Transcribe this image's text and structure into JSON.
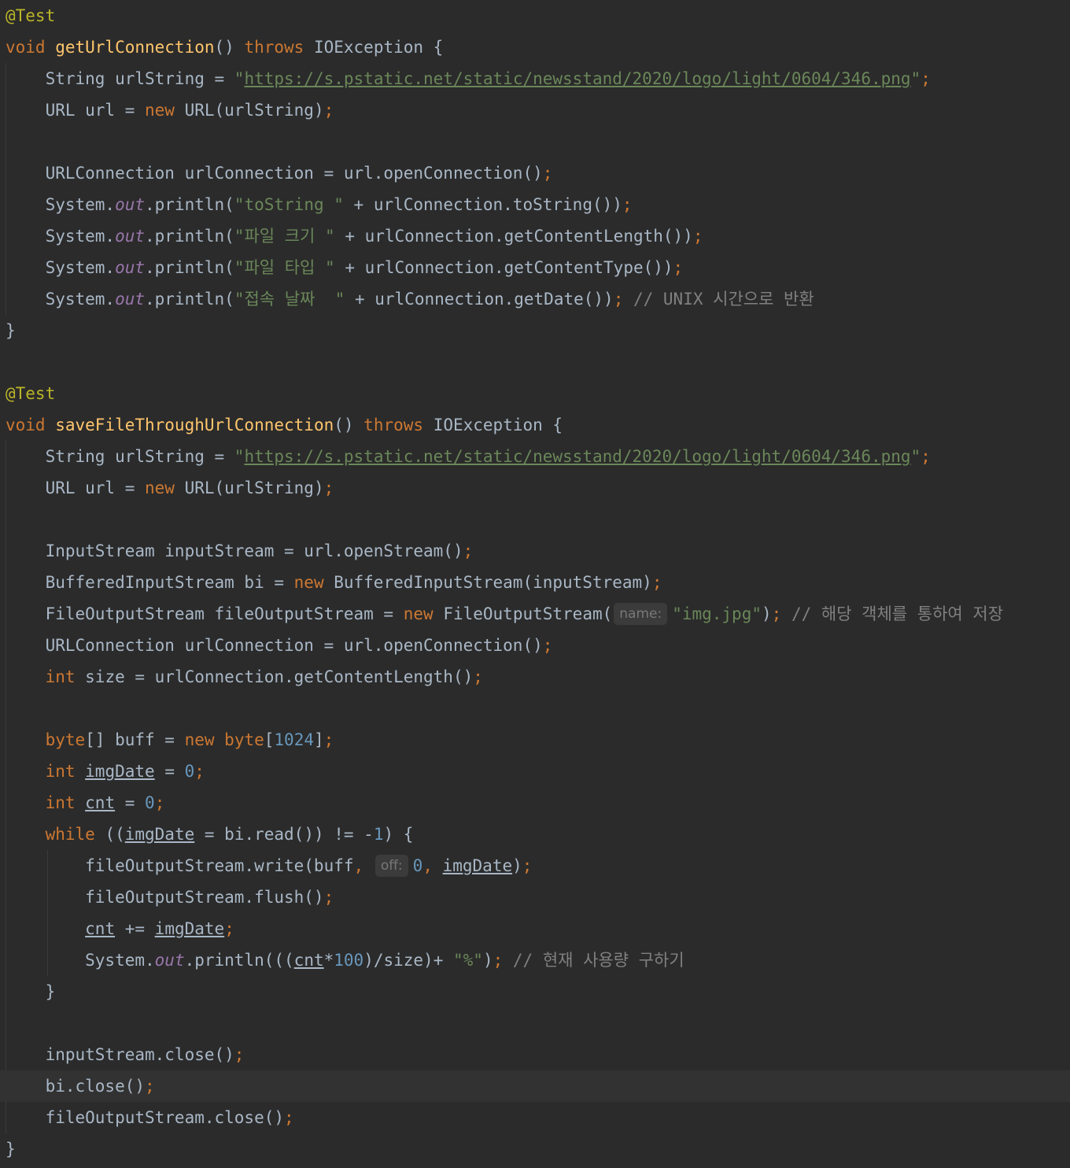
{
  "editor": {
    "lines": [
      [
        {
          "t": "@Test",
          "c": "ann"
        }
      ],
      [
        {
          "t": "void ",
          "c": "kw"
        },
        {
          "t": "getUrlConnection",
          "c": "fn"
        },
        {
          "t": "() "
        },
        {
          "t": "throws ",
          "c": "kw"
        },
        {
          "t": "IOException {"
        }
      ],
      [
        {
          "t": "    String urlString = "
        },
        {
          "t": "\"",
          "c": "str"
        },
        {
          "t": "https://s.pstatic.net/static/newsstand/2020/logo/light/0604/346.png",
          "c": "str link"
        },
        {
          "t": "\"",
          "c": "str"
        },
        {
          "t": ";",
          "c": "punc"
        }
      ],
      [
        {
          "t": "    URL url = "
        },
        {
          "t": "new ",
          "c": "kw"
        },
        {
          "t": "URL(urlString)"
        },
        {
          "t": ";",
          "c": "punc"
        }
      ],
      [],
      [
        {
          "t": "    URLConnection urlConnection = url.openConnection()"
        },
        {
          "t": ";",
          "c": "punc"
        }
      ],
      [
        {
          "t": "    System."
        },
        {
          "t": "out",
          "c": "stat"
        },
        {
          "t": ".println("
        },
        {
          "t": "\"toString \"",
          "c": "str"
        },
        {
          "t": " + urlConnection.toString())"
        },
        {
          "t": ";",
          "c": "punc"
        }
      ],
      [
        {
          "t": "    System."
        },
        {
          "t": "out",
          "c": "stat"
        },
        {
          "t": ".println("
        },
        {
          "t": "\"파일 크기 \"",
          "c": "str"
        },
        {
          "t": " + urlConnection.getContentLength())"
        },
        {
          "t": ";",
          "c": "punc"
        }
      ],
      [
        {
          "t": "    System."
        },
        {
          "t": "out",
          "c": "stat"
        },
        {
          "t": ".println("
        },
        {
          "t": "\"파일 타입 \"",
          "c": "str"
        },
        {
          "t": " + urlConnection.getContentType())"
        },
        {
          "t": ";",
          "c": "punc"
        }
      ],
      [
        {
          "t": "    System."
        },
        {
          "t": "out",
          "c": "stat"
        },
        {
          "t": ".println("
        },
        {
          "t": "\"접속 날짜  \"",
          "c": "str"
        },
        {
          "t": " + urlConnection.getDate())"
        },
        {
          "t": "; ",
          "c": "punc"
        },
        {
          "t": "// UNIX 시간으로 반환",
          "c": "cmt"
        }
      ],
      [
        {
          "t": "}"
        }
      ],
      [],
      [
        {
          "t": "@Test",
          "c": "ann"
        }
      ],
      [
        {
          "t": "void ",
          "c": "kw"
        },
        {
          "t": "saveFileThroughUrlConnection",
          "c": "fn"
        },
        {
          "t": "() "
        },
        {
          "t": "throws ",
          "c": "kw"
        },
        {
          "t": "IOException {"
        }
      ],
      [
        {
          "t": "    String urlString = "
        },
        {
          "t": "\"",
          "c": "str"
        },
        {
          "t": "https://s.pstatic.net/static/newsstand/2020/logo/light/0604/346.png",
          "c": "str link"
        },
        {
          "t": "\"",
          "c": "str"
        },
        {
          "t": ";",
          "c": "punc"
        }
      ],
      [
        {
          "t": "    URL url = "
        },
        {
          "t": "new ",
          "c": "kw"
        },
        {
          "t": "URL(urlString)"
        },
        {
          "t": ";",
          "c": "punc"
        }
      ],
      [],
      [
        {
          "t": "    InputStream inputStream = url.openStream()"
        },
        {
          "t": ";",
          "c": "punc"
        }
      ],
      [
        {
          "t": "    BufferedInputStream bi = "
        },
        {
          "t": "new ",
          "c": "kw"
        },
        {
          "t": "BufferedInputStream(inputStream)"
        },
        {
          "t": ";",
          "c": "punc"
        }
      ],
      [
        {
          "t": "    FileOutputStream fileOutputStream = "
        },
        {
          "t": "new ",
          "c": "kw"
        },
        {
          "t": "FileOutputStream("
        },
        {
          "t": "name:",
          "c": "hint"
        },
        {
          "t": "\"img.jpg\"",
          "c": "str"
        },
        {
          "t": ")"
        },
        {
          "t": "; ",
          "c": "punc"
        },
        {
          "t": "// 해당 객체를 통하여 저장",
          "c": "cmt"
        }
      ],
      [
        {
          "t": "    URLConnection urlConnection = url.openConnection()"
        },
        {
          "t": ";",
          "c": "punc"
        }
      ],
      [
        {
          "t": "    "
        },
        {
          "t": "int ",
          "c": "kw"
        },
        {
          "t": "size = urlConnection.getContentLength()"
        },
        {
          "t": ";",
          "c": "punc"
        }
      ],
      [],
      [
        {
          "t": "    "
        },
        {
          "t": "byte",
          "c": "kw"
        },
        {
          "t": "[] buff = "
        },
        {
          "t": "new ",
          "c": "kw"
        },
        {
          "t": "byte",
          "c": "kw"
        },
        {
          "t": "["
        },
        {
          "t": "1024",
          "c": "num"
        },
        {
          "t": "]"
        },
        {
          "t": ";",
          "c": "punc"
        }
      ],
      [
        {
          "t": "    "
        },
        {
          "t": "int ",
          "c": "kw"
        },
        {
          "t": "imgDate",
          "c": "uvar"
        },
        {
          "t": " = "
        },
        {
          "t": "0",
          "c": "num"
        },
        {
          "t": ";",
          "c": "punc"
        }
      ],
      [
        {
          "t": "    "
        },
        {
          "t": "int ",
          "c": "kw"
        },
        {
          "t": "cnt",
          "c": "uvar"
        },
        {
          "t": " = "
        },
        {
          "t": "0",
          "c": "num"
        },
        {
          "t": ";",
          "c": "punc"
        }
      ],
      [
        {
          "t": "    "
        },
        {
          "t": "while ",
          "c": "kw"
        },
        {
          "t": "(("
        },
        {
          "t": "imgDate",
          "c": "uvar"
        },
        {
          "t": " = bi.read()) != -"
        },
        {
          "t": "1",
          "c": "num"
        },
        {
          "t": ") {"
        }
      ],
      [
        {
          "t": "        fileOutputStream.write(buff"
        },
        {
          "t": ", ",
          "c": "punc"
        },
        {
          "t": "off:",
          "c": "hint"
        },
        {
          "t": "0",
          "c": "num"
        },
        {
          "t": ", ",
          "c": "punc"
        },
        {
          "t": "imgDate",
          "c": "uvar"
        },
        {
          "t": ")"
        },
        {
          "t": ";",
          "c": "punc"
        }
      ],
      [
        {
          "t": "        fileOutputStream.flush()"
        },
        {
          "t": ";",
          "c": "punc"
        }
      ],
      [
        {
          "t": "        "
        },
        {
          "t": "cnt",
          "c": "uvar"
        },
        {
          "t": " += "
        },
        {
          "t": "imgDate",
          "c": "uvar"
        },
        {
          "t": ";",
          "c": "punc"
        }
      ],
      [
        {
          "t": "        System."
        },
        {
          "t": "out",
          "c": "stat"
        },
        {
          "t": ".println((("
        },
        {
          "t": "cnt",
          "c": "uvar"
        },
        {
          "t": "*"
        },
        {
          "t": "100",
          "c": "num"
        },
        {
          "t": ")/size)+ "
        },
        {
          "t": "\"%\"",
          "c": "str"
        },
        {
          "t": ")"
        },
        {
          "t": "; ",
          "c": "punc"
        },
        {
          "t": "// 현재 사용량 구하기",
          "c": "cmt"
        }
      ],
      [
        {
          "t": "    }"
        }
      ],
      [],
      [
        {
          "t": "    inputStream.close()"
        },
        {
          "t": ";",
          "c": "punc"
        }
      ],
      [
        {
          "t": "    bi.close()"
        },
        {
          "t": ";",
          "c": "punc"
        }
      ],
      [
        {
          "t": "    fileOutputStream.close()"
        },
        {
          "t": ";",
          "c": "punc"
        }
      ],
      [
        {
          "t": "}"
        }
      ]
    ],
    "current_line": 34,
    "colors": {
      "background": "#2b2b2b",
      "current_line": "#323232",
      "default_text": "#a9b7c6",
      "keyword": "#cc7832",
      "annotation": "#bbb529",
      "method_declaration": "#ffc66d",
      "string": "#6a8759",
      "number": "#6897bb",
      "comment": "#808080",
      "static_field": "#9876aa"
    }
  }
}
